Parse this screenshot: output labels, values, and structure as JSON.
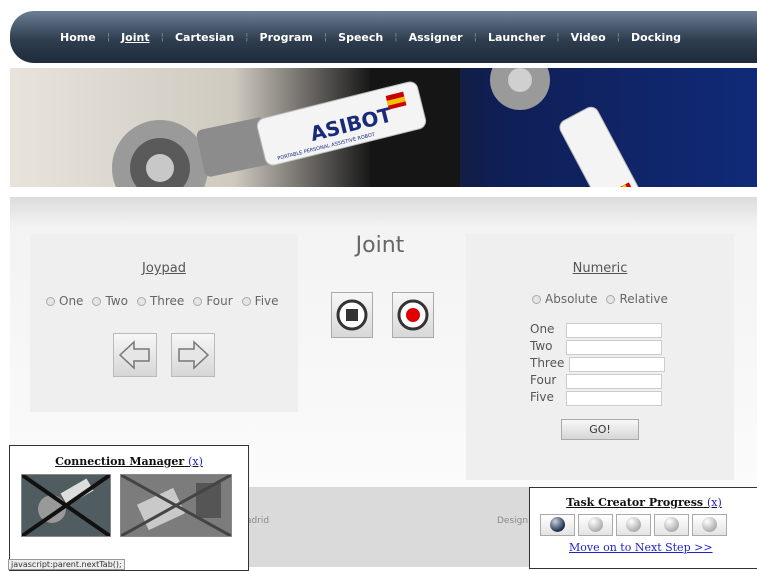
{
  "nav": {
    "items": [
      "Home",
      "Joint",
      "Cartesian",
      "Program",
      "Speech",
      "Assigner",
      "Launcher",
      "Video",
      "Docking"
    ],
    "active": "Joint"
  },
  "banner": {
    "robot_label": "ASIBOT",
    "robot_sublabel": "PORTABLE PERSONAL ASSISTIVE ROBOT"
  },
  "joypad": {
    "title": "Joypad",
    "radios": [
      "One",
      "Two",
      "Three",
      "Four",
      "Five"
    ],
    "left_icon": "arrow-left-icon",
    "right_icon": "arrow-right-icon"
  },
  "joint": {
    "title": "Joint",
    "stop_icon": "stop-icon",
    "record_icon": "record-icon"
  },
  "numeric": {
    "title": "Numeric",
    "modes": [
      "Absolute",
      "Relative"
    ],
    "fields": [
      "One",
      "Two",
      "Three",
      "Four",
      "Five"
    ],
    "go_label": "GO!"
  },
  "footer": {
    "left_fragment": "adrid",
    "right_fragment": "Design"
  },
  "connection_manager": {
    "title": "Connection Manager",
    "close": "(x)"
  },
  "task_creator": {
    "title": "Task Creator Progress",
    "close": "(x)",
    "steps": 5,
    "current_step": 1,
    "next_link": "Move on to Next Step >>"
  },
  "status_bar": {
    "text": "javascript:parent.nextTab();"
  },
  "colors": {
    "nav_dark": "#2f3e50",
    "link_blue": "#2222cc",
    "record_red": "#e00000"
  }
}
